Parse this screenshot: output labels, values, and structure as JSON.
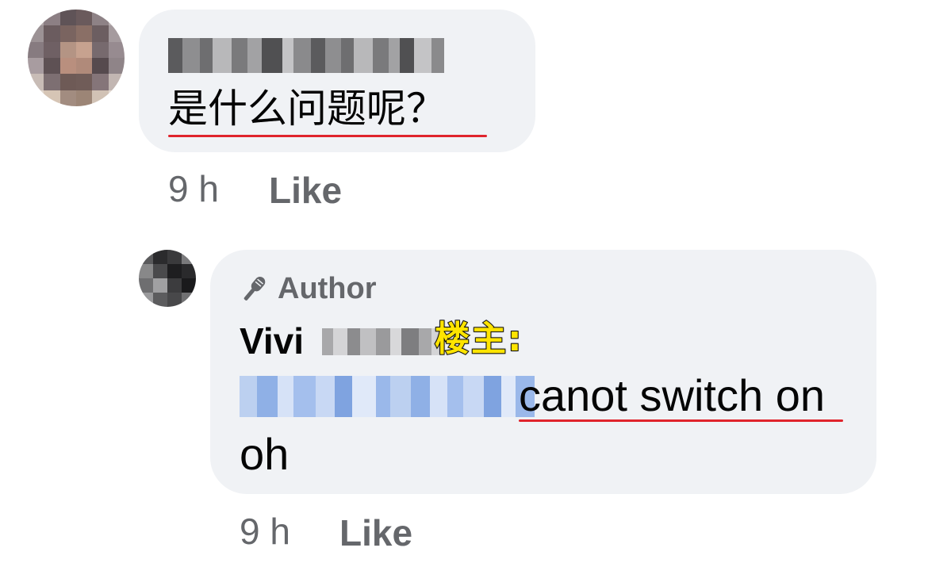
{
  "comment": {
    "author_name_redacted": true,
    "text": "是什么问题呢？",
    "time": "9 h",
    "like_label": "Like"
  },
  "reply": {
    "badge_label": "Author",
    "badge_icon": "microphone-icon",
    "author_first_name": "Vivi",
    "op_tag": "楼主:",
    "mention_redacted": true,
    "text_line1": "canot switch on",
    "text_line2": "oh",
    "time": "9 h",
    "like_label": "Like"
  },
  "colors": {
    "bubble_bg": "#f0f2f5",
    "meta_gray": "#65676b",
    "underline_red": "#e0242c",
    "op_tag_yellow": "#ffe400",
    "mention_blue": "#aac4ec"
  }
}
